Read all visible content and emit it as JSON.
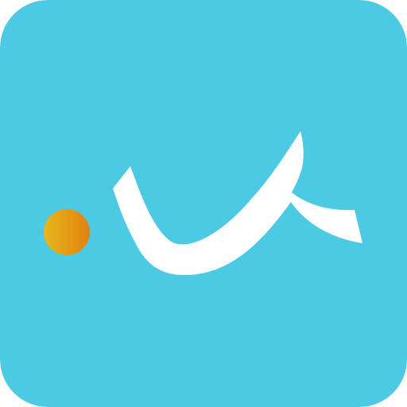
{
  "app_icon": {
    "symbol": "dot-and-wave-mark-icon",
    "colors": {
      "background": "#4CC9E3",
      "mark": "#FFFFFF",
      "dot_gradient_start": "#E8B81C",
      "dot_gradient_end": "#E2800E"
    }
  }
}
